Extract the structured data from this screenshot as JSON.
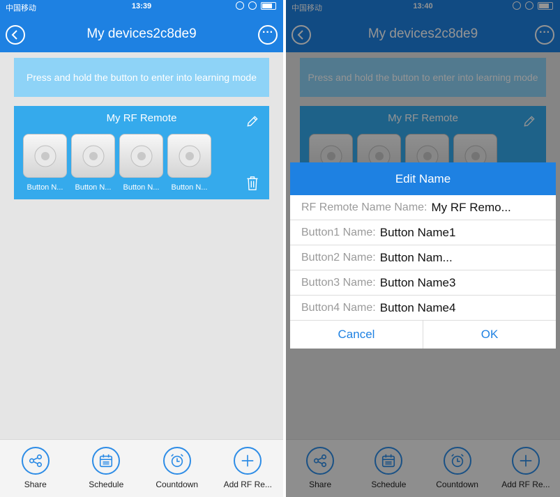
{
  "colors": {
    "header": "#1e81e2",
    "hint": "#8ed3f7",
    "remote": "#35aaec",
    "accent": "#2d8ce6"
  },
  "left": {
    "status": {
      "carrier": "中国移动",
      "time": "13:39"
    },
    "nav": {
      "title": "My devices2c8de9",
      "back_icon": "chevron-left-icon",
      "more_icon": "more-icon"
    },
    "hint": "Press and hold the button to enter into learning mode",
    "remote": {
      "name": "My RF Remote",
      "buttons": [
        {
          "label": "Button N..."
        },
        {
          "label": "Button N..."
        },
        {
          "label": "Button N..."
        },
        {
          "label": "Button N..."
        }
      ]
    },
    "tabs": [
      {
        "label": "Share",
        "icon": "share-icon"
      },
      {
        "label": "Schedule",
        "icon": "calendar-icon"
      },
      {
        "label": "Countdown",
        "icon": "alarm-clock-icon"
      },
      {
        "label": "Add RF Re...",
        "icon": "plus-icon"
      }
    ]
  },
  "right": {
    "status": {
      "carrier": "中国移动",
      "time": "13:40"
    },
    "nav": {
      "title": "My devices2c8de9"
    },
    "hint": "Press and hold the button to enter into learning mode",
    "remote": {
      "name": "My RF Remote"
    },
    "tabs": [
      {
        "label": "Share"
      },
      {
        "label": "Schedule"
      },
      {
        "label": "Countdown"
      },
      {
        "label": "Add RF Re..."
      }
    ],
    "dialog": {
      "title": "Edit Name",
      "fields": [
        {
          "label": "RF Remote Name Name:",
          "value": "My RF Remo..."
        },
        {
          "label": "Button1 Name:",
          "value": "Button Name1"
        },
        {
          "label": "Button2 Name:",
          "value": "Button Nam..."
        },
        {
          "label": "Button3 Name:",
          "value": "Button Name3"
        },
        {
          "label": "Button4 Name:",
          "value": "Button Name4"
        }
      ],
      "cancel": "Cancel",
      "ok": "OK"
    }
  }
}
